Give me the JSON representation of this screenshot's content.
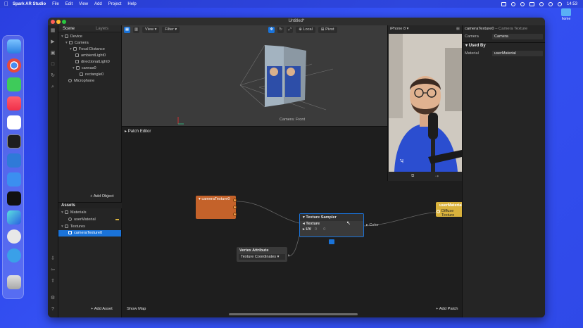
{
  "menubar": {
    "app_name": "Spark AR Studio",
    "items": [
      "File",
      "Edit",
      "View",
      "Add",
      "Project",
      "Help"
    ],
    "clock": "14:53"
  },
  "desktop": {
    "folder_label": "home"
  },
  "window": {
    "title": "Untitled*"
  },
  "scene": {
    "tabs": [
      "Scene",
      "Layers"
    ],
    "tree": [
      "Device",
      "Camera",
      "Focal Distance",
      "ambientLight0",
      "directionalLight0",
      "canvas0",
      "rectangle0",
      "Microphone"
    ],
    "add_object": "Add Object"
  },
  "assets": {
    "title": "Assets",
    "tree": [
      "Materials",
      "userMaterial",
      "Textures",
      "cameraTexture0"
    ],
    "add_asset": "Add Asset"
  },
  "viewport": {
    "view_label": "View",
    "filter_label": "Filter",
    "local_label": "Local",
    "pivot_label": "Pivot",
    "camera_label": "Camera: Front"
  },
  "patch_editor": {
    "title": "Patch Editor",
    "camera_node": "cameraTexture0",
    "sampler_title": "Texture Sampler",
    "sampler_in_texture": "Texture",
    "sampler_in_uv": "UV",
    "sampler_out": "Color",
    "material_title": "userMaterial",
    "material_port": "Diffuse Texture",
    "vertex_title": "Vertex Attribute",
    "vertex_select": "Texture Coordinates",
    "show_map": "Show Map",
    "add_patch": "Add Patch"
  },
  "simulator": {
    "device": "iPhone 8"
  },
  "properties": {
    "title": "cameraTexture0",
    "subtitle": "– Camera Texture",
    "camera_label": "Camera",
    "camera_value": "Camera",
    "used_by": "Used By",
    "material_label": "Material",
    "material_value": "userMaterial"
  },
  "colors": {
    "accent": "#1a73d9",
    "patch_orange": "#c4622a",
    "material_yellow": "#d9b23c",
    "desktop": "#2f49e8"
  }
}
